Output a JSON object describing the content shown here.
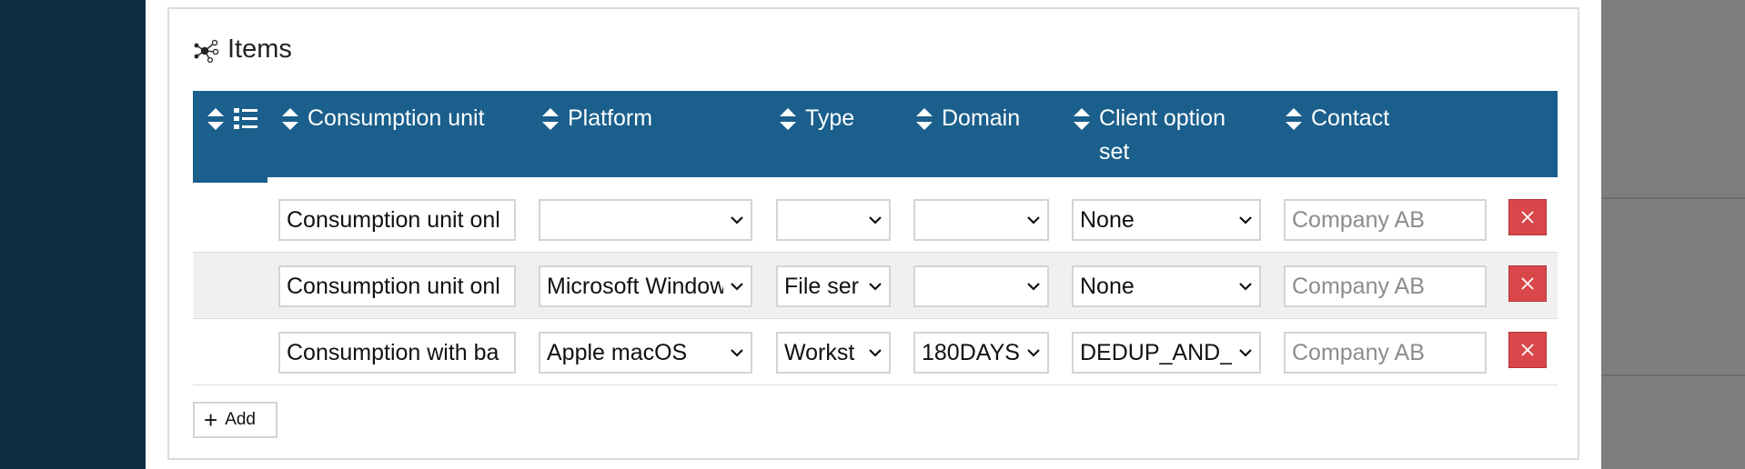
{
  "section": {
    "title": "Items",
    "icon": "network-nodes-icon"
  },
  "table": {
    "columns": [
      {
        "label": ""
      },
      {
        "label": "Consumption unit"
      },
      {
        "label": "Platform"
      },
      {
        "label": "Type"
      },
      {
        "label": "Domain"
      },
      {
        "label": "Client option set"
      },
      {
        "label": "Contact"
      }
    ],
    "rows": [
      {
        "consumption_unit": "Consumption unit onl",
        "platform": "",
        "type": "",
        "domain": "",
        "client_option_set": "None",
        "contact_placeholder": "Company AB"
      },
      {
        "consumption_unit": "Consumption unit onl",
        "platform": "Microsoft Window",
        "type": "File ser",
        "domain": "",
        "client_option_set": "None",
        "contact_placeholder": "Company AB"
      },
      {
        "consumption_unit": "Consumption with ba",
        "platform": "Apple macOS",
        "type": "Workst",
        "domain": "180DAYS",
        "client_option_set": "DEDUP_AND_",
        "contact_placeholder": "Company AB"
      }
    ]
  },
  "add_button": {
    "label": "Add"
  },
  "colors": {
    "header_bg": "#1b5f8c",
    "delete_bg": "#d9474a",
    "sidebar_bg": "#0f2e44"
  }
}
